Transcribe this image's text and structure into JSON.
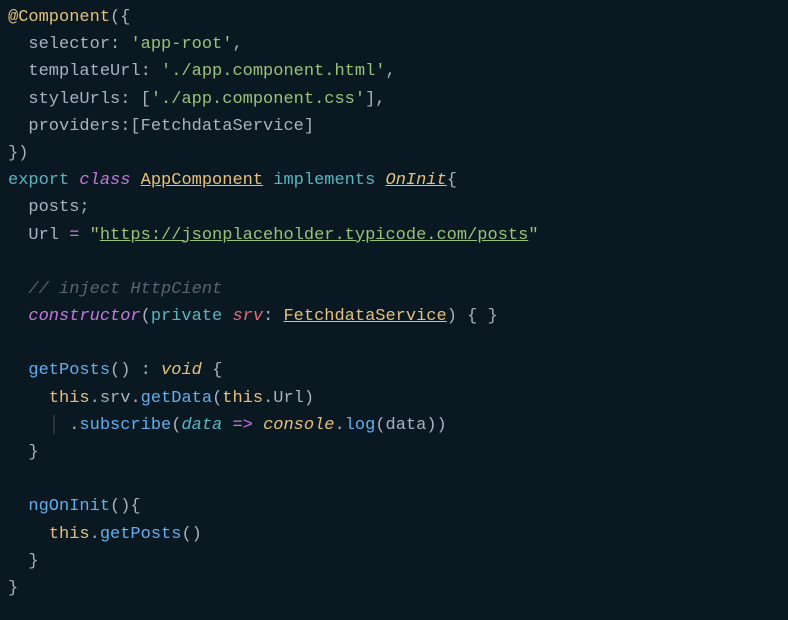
{
  "code": {
    "decorator": "@Component",
    "selector_key": "selector",
    "selector_val": "'app-root'",
    "templateUrl_key": "templateUrl",
    "templateUrl_val": "'./app.component.html'",
    "styleUrls_key": "styleUrls",
    "styleUrls_val": "'./app.component.css'",
    "providers_key": "providers",
    "providers_val": "FetchdataService",
    "export_kw": "export",
    "class_kw": "class",
    "class_name": "AppComponent",
    "implements_kw": "implements",
    "interface_name": "OnInit",
    "posts_ident": "posts",
    "url_ident": "Url",
    "url_val_open": "\"",
    "url_val": "https://jsonplaceholder.typicode.com/posts",
    "url_val_close": "\"",
    "comment": "// inject HttpCient",
    "constructor_kw": "constructor",
    "private_kw": "private",
    "srv_param": "srv",
    "srv_type": "FetchdataService",
    "getPosts_name": "getPosts",
    "void_type": "void",
    "this_kw": "this",
    "srv_prop": "srv",
    "getData_name": "getData",
    "url_prop": "Url",
    "subscribe_name": "subscribe",
    "data_param": "data",
    "arrow": "=>",
    "console_obj": "console",
    "log_name": "log",
    "ngOnInit_name": "ngOnInit"
  }
}
